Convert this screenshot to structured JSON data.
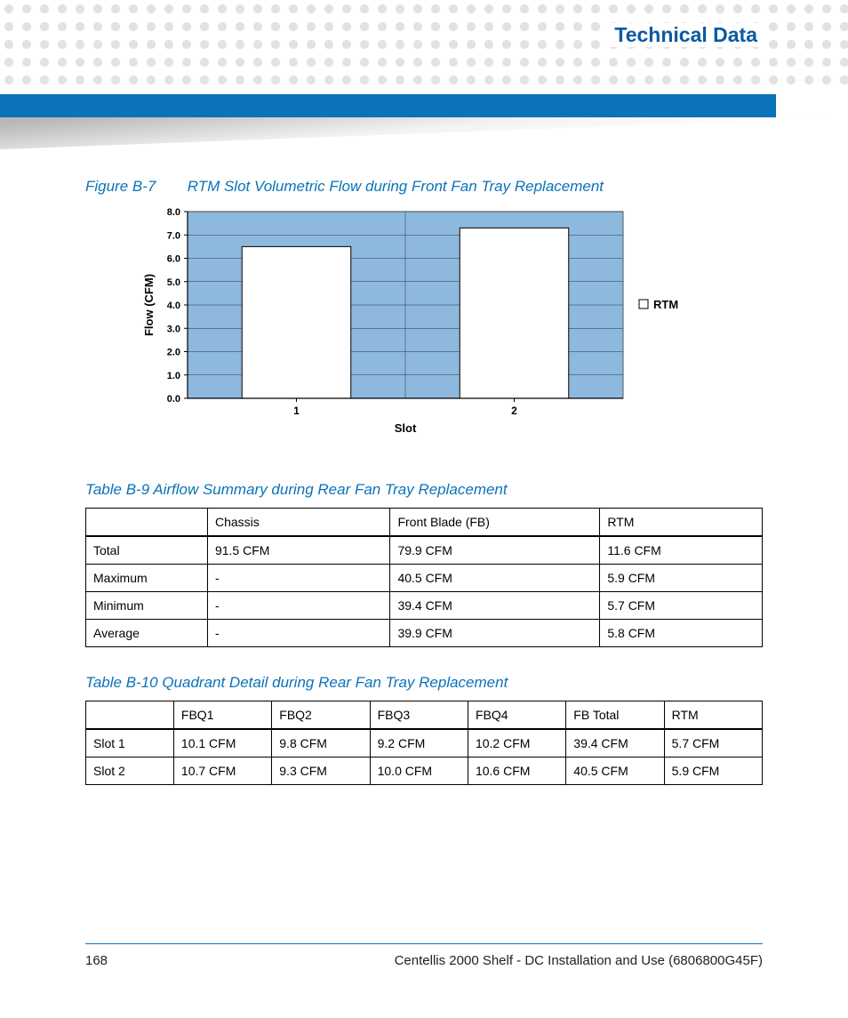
{
  "header": {
    "title": "Technical Data"
  },
  "figure": {
    "label": "Figure B-7",
    "title": "RTM Slot Volumetric Flow during Front Fan Tray Replacement"
  },
  "chart_data": {
    "type": "bar",
    "categories": [
      "1",
      "2"
    ],
    "series": [
      {
        "name": "RTM",
        "values": [
          6.5,
          7.3
        ]
      }
    ],
    "xlabel": "Slot",
    "ylabel": "Flow (CFM)",
    "ylim": [
      0,
      8
    ],
    "yticks": [
      "0.0",
      "1.0",
      "2.0",
      "3.0",
      "4.0",
      "5.0",
      "6.0",
      "7.0",
      "8.0"
    ],
    "legend": [
      "RTM"
    ]
  },
  "table1": {
    "caption": "Table B-9 Airflow Summary during Rear Fan Tray Replacement",
    "headers": [
      "",
      "Chassis",
      "Front Blade (FB)",
      "RTM"
    ],
    "rows": [
      [
        "Total",
        "91.5 CFM",
        "79.9 CFM",
        "11.6 CFM"
      ],
      [
        "Maximum",
        "-",
        "40.5 CFM",
        "5.9 CFM"
      ],
      [
        "Minimum",
        "-",
        "39.4 CFM",
        "5.7 CFM"
      ],
      [
        "Average",
        "-",
        "39.9 CFM",
        "5.8 CFM"
      ]
    ]
  },
  "table2": {
    "caption": "Table B-10 Quadrant Detail during Rear Fan Tray Replacement",
    "headers": [
      "",
      "FBQ1",
      "FBQ2",
      "FBQ3",
      "FBQ4",
      "FB Total",
      "RTM"
    ],
    "rows": [
      [
        "Slot 1",
        "10.1 CFM",
        "9.8 CFM",
        "9.2 CFM",
        "10.2 CFM",
        "39.4 CFM",
        "5.7 CFM"
      ],
      [
        "Slot 2",
        "10.7 CFM",
        "9.3 CFM",
        "10.0 CFM",
        "10.6 CFM",
        "40.5 CFM",
        "5.9 CFM"
      ]
    ]
  },
  "footer": {
    "page": "168",
    "doc": "Centellis 2000 Shelf - DC Installation and Use (6806800G45F)"
  }
}
